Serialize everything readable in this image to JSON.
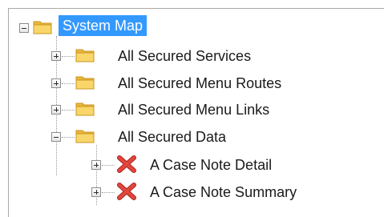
{
  "tree": {
    "root": {
      "label": "System Map",
      "expanded": true,
      "selected": true,
      "icon": "folder-icon"
    },
    "children": [
      {
        "label": "All Secured Services",
        "expanded": false,
        "icon": "folder-icon"
      },
      {
        "label": "All Secured Menu Routes",
        "expanded": false,
        "icon": "folder-icon"
      },
      {
        "label": "All Secured Menu Links",
        "expanded": false,
        "icon": "folder-icon"
      },
      {
        "label": "All Secured Data",
        "expanded": true,
        "icon": "folder-icon",
        "children": [
          {
            "label": "A Case Note Detail",
            "expanded": false,
            "icon": "red-x-icon"
          },
          {
            "label": "A Case Note Summary",
            "expanded": false,
            "icon": "red-x-icon"
          }
        ]
      }
    ]
  },
  "colors": {
    "selection": "#3399ff",
    "folder": "#f3c84a",
    "error_x": "#d9342b"
  }
}
